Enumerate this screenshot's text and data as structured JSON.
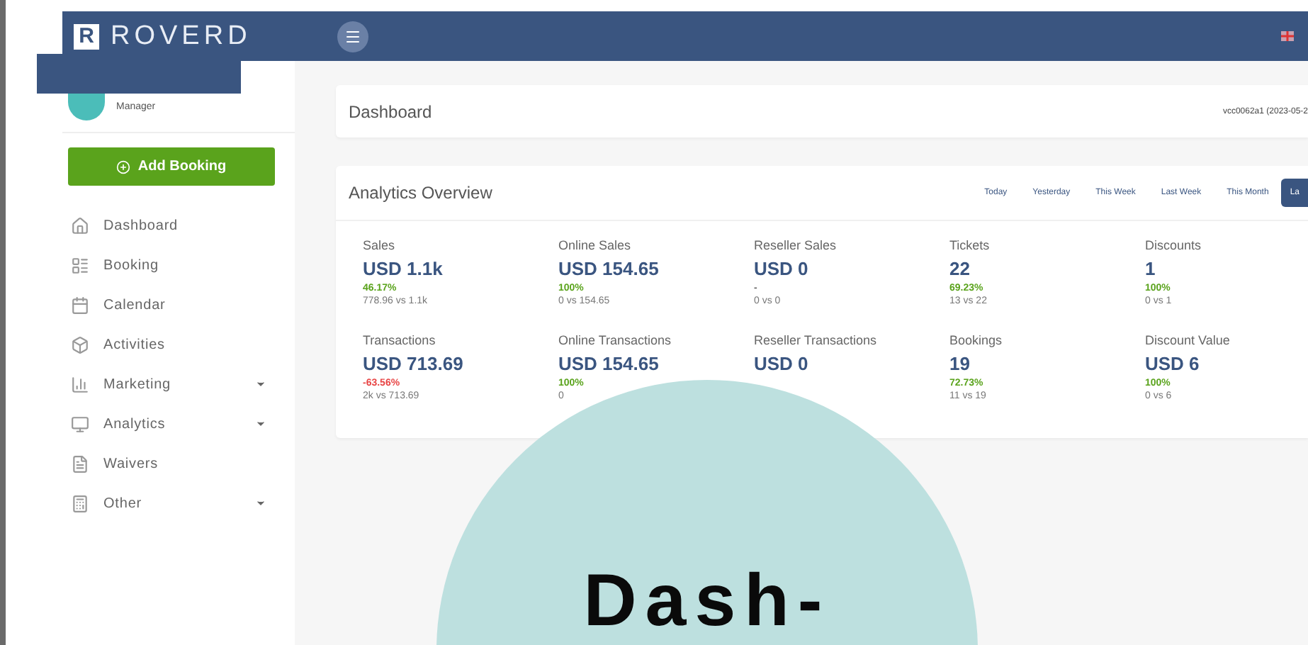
{
  "topbar": {
    "logo_letter": "R",
    "logo_text": "ROVERD"
  },
  "sidebar": {
    "user_role": "Manager",
    "add_button": "Add Booking",
    "items": [
      {
        "label": "Dashboard",
        "has_submenu": false
      },
      {
        "label": "Booking",
        "has_submenu": false
      },
      {
        "label": "Calendar",
        "has_submenu": false
      },
      {
        "label": "Activities",
        "has_submenu": false
      },
      {
        "label": "Marketing",
        "has_submenu": true
      },
      {
        "label": "Analytics",
        "has_submenu": true
      },
      {
        "label": "Waivers",
        "has_submenu": false
      },
      {
        "label": "Other",
        "has_submenu": true
      }
    ]
  },
  "page_header": {
    "title": "Dashboard",
    "version": "vcc0062a1 (2023-05-2"
  },
  "analytics": {
    "title": "Analytics Overview",
    "periods": [
      {
        "label": "Today",
        "selected": false
      },
      {
        "label": "Yesterday",
        "selected": false
      },
      {
        "label": "This Week",
        "selected": false
      },
      {
        "label": "Last Week",
        "selected": false
      },
      {
        "label": "This Month",
        "selected": false
      },
      {
        "label": "La",
        "selected": true
      }
    ],
    "stats": [
      {
        "label": "Sales",
        "value": "USD 1.1k",
        "change": "46.17%",
        "kind": "gain",
        "compare": "778.96 vs 1.1k"
      },
      {
        "label": "Online Sales",
        "value": "USD 154.65",
        "change": "100%",
        "kind": "gain",
        "compare": "0 vs 154.65"
      },
      {
        "label": "Reseller Sales",
        "value": "USD 0",
        "change": "-",
        "kind": "flat",
        "compare": "0 vs 0"
      },
      {
        "label": "Tickets",
        "value": "22",
        "change": "69.23%",
        "kind": "gain",
        "compare": "13 vs 22"
      },
      {
        "label": "Discounts",
        "value": "1",
        "change": "100%",
        "kind": "gain",
        "compare": "0 vs 1"
      },
      {
        "label": "Transactions",
        "value": "USD 713.69",
        "change": "-63.56%",
        "kind": "loss",
        "compare": "2k vs 713.69"
      },
      {
        "label": "Online Transactions",
        "value": "USD 154.65",
        "change": "100%",
        "kind": "gain",
        "compare": "0"
      },
      {
        "label": "Reseller Transactions",
        "value": "USD 0"
      },
      {
        "label": "Bookings",
        "value": "19",
        "change": "72.73%",
        "kind": "gain",
        "compare": "11 vs 19"
      },
      {
        "label": "Discount Value",
        "value": "USD 6",
        "change": "100%",
        "kind": "gain",
        "compare": "0 vs 6"
      }
    ]
  },
  "overlay": {
    "heading": "Dash-"
  }
}
